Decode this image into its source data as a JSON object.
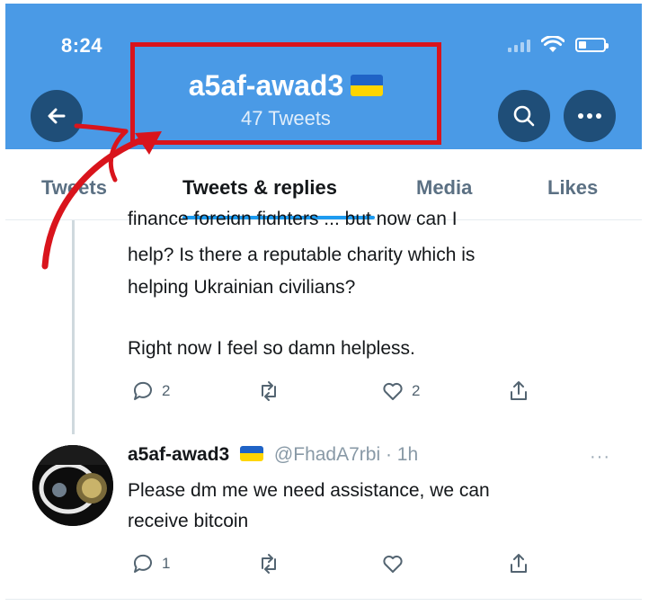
{
  "status_bar": {
    "time": "8:24"
  },
  "header": {
    "title": "a5af-awad3",
    "subtitle": "47 Tweets",
    "back_icon": "arrow-left-icon",
    "search_icon": "search-icon",
    "more_icon": "more-horizontal-icon"
  },
  "tabs": [
    {
      "label": "Tweets",
      "active": false
    },
    {
      "label": "Tweets & replies",
      "active": true
    },
    {
      "label": "Media",
      "active": false
    },
    {
      "label": "Likes",
      "active": false
    }
  ],
  "tweet1": {
    "cut_text": "finance foreign fighters ... but now can I",
    "lines": [
      "help? Is there a reputable charity which is",
      "helping Ukrainian civilians?",
      "",
      "Right now I feel so damn helpless."
    ],
    "replies": "2",
    "retweets": "",
    "likes": "2"
  },
  "tweet2": {
    "name": "a5af-awad3",
    "handle": "@FhadA7rbi",
    "time": "· 1h",
    "more": "···",
    "lines": [
      "Please dm me we need assistance,  we can",
      "receive bitcoin"
    ],
    "replies": "1",
    "retweets": "",
    "likes": ""
  },
  "colors": {
    "header_bg": "#4a9ae6",
    "header_buttons": "#1f4e78",
    "annotation_red": "#d9141c",
    "tab_accent": "#1d9bf0"
  }
}
